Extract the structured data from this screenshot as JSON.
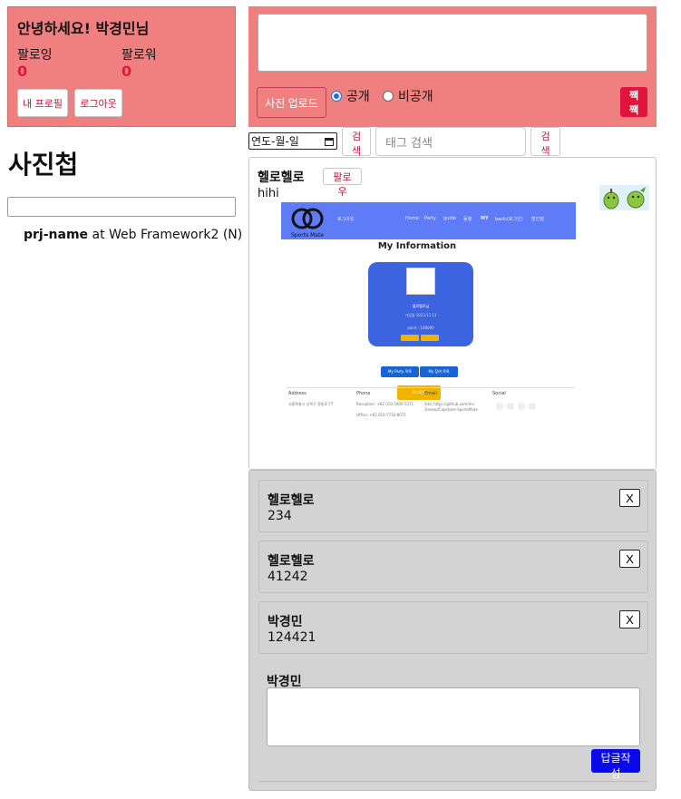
{
  "profile": {
    "greeting": "안녕하세요! 박경민님",
    "following_label": "팔로잉",
    "following_count": "0",
    "follower_label": "팔로워",
    "follower_count": "0",
    "my_profile_button": "내 프로필",
    "logout_button": "로그아웃"
  },
  "sidebar": {
    "album_title": "사진첩",
    "credit_project": "prj-name",
    "credit_rest": " at Web Framework2 (N)"
  },
  "composer": {
    "textarea_value": "",
    "upload_button": "사진 업로드",
    "public_label": "공개",
    "private_label": "비공개",
    "selected_visibility": "공개",
    "submit_button": "짹짹"
  },
  "search": {
    "date_placeholder": "연도-월-일",
    "date_search_button": "검색",
    "tag_placeholder": "태그 검색",
    "tag_search_button": "검색"
  },
  "post": {
    "author": "헬로헬로",
    "follow_button": "팔로우",
    "text": "hihi",
    "embedded_screenshot": {
      "logo_text": "Sports Mate",
      "nav_links": [
        "로그아웃",
        "Home",
        "Party",
        "guide",
        "동행",
        "MY",
        "basic(로그인)",
        "할인점"
      ],
      "heading": "My Information",
      "card_name": "헬로헬로님",
      "card_date": "가입일 2023.11.11",
      "card_points": "point : 100000",
      "buttons": [
        "My Party 목록",
        "My 참여 목록"
      ],
      "logout": "로그아웃",
      "footer_headers": [
        "Address",
        "Phone",
        "Email",
        "Social"
      ],
      "footer_address": "서울특별시 성북구 정릉로 77",
      "footer_phone": "Reception: +82 010-5000-5371",
      "footer_email": "Office: +82 010-7732-8071",
      "footer_github": "Site: https://github.com/ms-3/seoul/Capstone-SportsMate"
    }
  },
  "comments": [
    {
      "author": "헬로헬로",
      "text": "234",
      "delete_label": "X"
    },
    {
      "author": "헬로헬로",
      "text": "41242",
      "delete_label": "X"
    },
    {
      "author": "박경민",
      "text": "124421",
      "delete_label": "X"
    }
  ],
  "reply": {
    "author": "박경민",
    "textarea_value": "",
    "submit_button": "답글작성"
  }
}
